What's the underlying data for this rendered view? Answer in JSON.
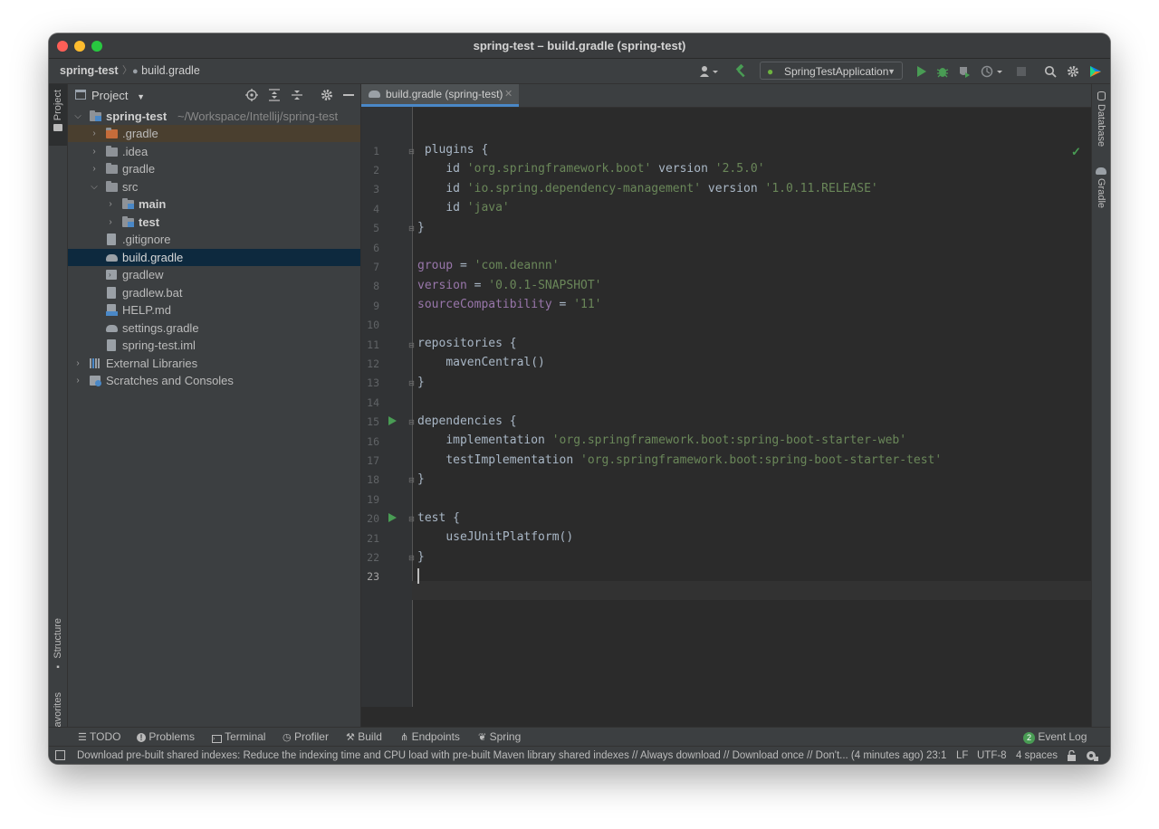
{
  "window": {
    "title": "spring-test – build.gradle (spring-test)"
  },
  "breadcrumb": {
    "project": "spring-test",
    "file": "build.gradle"
  },
  "toolbar": {
    "run_config": "SpringTestApplication"
  },
  "left_strip": {
    "project_label": "Project",
    "structure_label": "Structure",
    "favorites_label": "Favorites"
  },
  "right_strip": {
    "database_label": "Database",
    "gradle_label": "Gradle"
  },
  "project_panel": {
    "title": "Project",
    "root": {
      "name": "spring-test",
      "path": "~/Workspace/Intellij/spring-test"
    },
    "items": [
      {
        "label": ".gradle"
      },
      {
        "label": ".idea"
      },
      {
        "label": "gradle"
      },
      {
        "label": "src"
      },
      {
        "label": "main"
      },
      {
        "label": "test"
      },
      {
        "label": ".gitignore"
      },
      {
        "label": "build.gradle"
      },
      {
        "label": "gradlew"
      },
      {
        "label": "gradlew.bat"
      },
      {
        "label": "HELP.md"
      },
      {
        "label": "settings.gradle"
      },
      {
        "label": "spring-test.iml"
      },
      {
        "label": "External Libraries"
      },
      {
        "label": "Scratches and Consoles"
      }
    ]
  },
  "editor": {
    "tab_label": "build.gradle (spring-test)",
    "line_numbers": [
      "1",
      "2",
      "3",
      "4",
      "5",
      "6",
      "7",
      "8",
      "9",
      "10",
      "11",
      "12",
      "13",
      "14",
      "15",
      "16",
      "17",
      "18",
      "19",
      "20",
      "21",
      "22",
      "23"
    ],
    "tokens": {
      "plugins": "plugins {",
      "id": "id",
      "version": "version",
      "spring_boot_id": "'org.springframework.boot'",
      "spring_boot_ver": "'2.5.0'",
      "depmgmt_id": "'io.spring.dependency-management'",
      "depmgmt_ver": "'1.0.11.RELEASE'",
      "java_id": "'java'",
      "close": "}",
      "group": "group",
      "eq": " = ",
      "group_val": "'com.deannn'",
      "version_prop": "version",
      "version_val": "'0.0.1-SNAPSHOT'",
      "source_compat": "sourceCompatibility",
      "source_val": "'11'",
      "repositories": "repositories {",
      "maven_central": "mavenCentral()",
      "dependencies": "dependencies {",
      "implementation": "implementation",
      "impl_val": "'org.springframework.boot:spring-boot-starter-web'",
      "test_implementation": "testImplementation",
      "test_impl_val": "'org.springframework.boot:spring-boot-starter-test'",
      "test_block": "test {",
      "use_junit": "useJUnitPlatform()"
    }
  },
  "bottom_tabs": {
    "todo": "TODO",
    "problems": "Problems",
    "terminal": "Terminal",
    "profiler": "Profiler",
    "build": "Build",
    "endpoints": "Endpoints",
    "spring": "Spring",
    "event_log_count": "2",
    "event_log": "Event Log"
  },
  "status_bar": {
    "message": "Download pre-built shared indexes: Reduce the indexing time and CPU load with pre-built Maven library shared indexes // Always download // Download once // Don't... (4 minutes ago)",
    "position": "23:1",
    "line_sep": "LF",
    "encoding": "UTF-8",
    "indent": "4 spaces"
  },
  "colors": {
    "accent": "#4a88c7",
    "keyword": "#cc7832",
    "string": "#6a8759",
    "property": "#9876aa",
    "run_green": "#499c54",
    "selection": "#0d293e"
  }
}
